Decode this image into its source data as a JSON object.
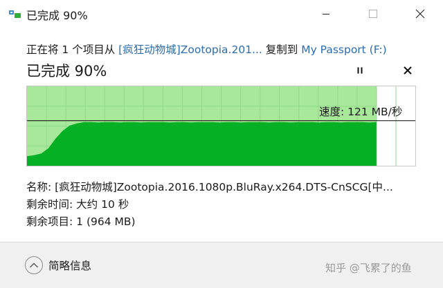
{
  "window": {
    "title": "已完成 90%",
    "buttons": {
      "minimize": "minimize-icon",
      "maximize": "maximize-icon",
      "close": "close-icon"
    }
  },
  "copy": {
    "prefix": "正在将 1 个项目从 ",
    "source": "[疯狂动物城]Zootopia.201...",
    "middle": " 复制到 ",
    "destination": "My Passport (F:)"
  },
  "progress": {
    "title": "已完成 90%",
    "percent": 90,
    "speed_label": "速度: 121 MB/秒",
    "speed_samples": [
      0.22,
      0.24,
      0.28,
      0.4,
      0.62,
      0.8,
      0.92,
      0.97,
      1.0,
      1.0,
      0.99,
      1.0,
      1.0,
      0.99,
      1.0,
      1.0,
      0.99,
      1.0,
      1.0,
      1.0,
      0.99,
      1.0,
      1.0,
      0.99,
      1.0,
      1.0,
      1.0,
      0.99,
      1.0,
      1.0,
      0.99,
      1.0,
      1.0,
      1.0,
      0.99,
      1.0,
      1.0,
      0.99,
      1.0,
      1.0,
      1.0,
      0.99,
      1.0,
      1.0,
      0.99,
      1.0,
      1.0,
      1.0,
      0.99,
      1.0
    ],
    "current_speed_level": 1.0,
    "controls": {
      "pause": "pause-icon",
      "cancel": "cancel-icon"
    },
    "colors": {
      "done_area": "#a8e89a",
      "fill": "#06b025",
      "grid": "#8fd98c",
      "speed_line": "#000000"
    }
  },
  "details": {
    "name": "名称: [疯狂动物城]Zootopia.2016.1080p.BluRay.x264.DTS-CnSCG[中...",
    "time_remaining": "剩余时间: 大约 10 秒",
    "items_remaining": "剩余项目: 1 (964 MB)"
  },
  "footer": {
    "toggle_label": "简略信息",
    "toggle_icon": "chevron-up-icon",
    "watermark": "知乎 @飞累了的鱼"
  }
}
